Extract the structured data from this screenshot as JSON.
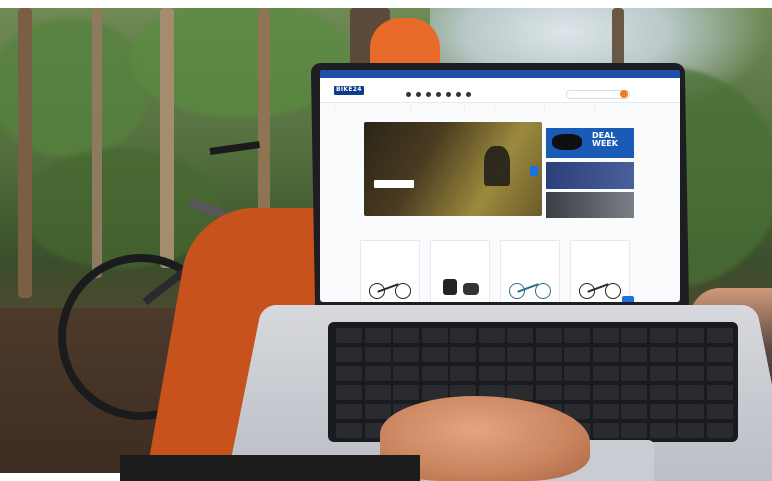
{
  "scene": {
    "description": "Laptop on a hammock in a forest showing a bike shop web page",
    "colors": {
      "hammock": "#e86a2a",
      "brand_blue": "#1f4fa8",
      "deal_blue": "#1a5bb5",
      "cart_orange": "#f07c22"
    }
  },
  "site": {
    "topbar_text": "",
    "logo_text": "BIKE24",
    "header_links": [
      "",
      ""
    ],
    "nav_items": [
      "",
      "",
      "",
      "",
      "",
      ""
    ],
    "hero": {
      "title_line1": "",
      "title_line2": "",
      "button_label": ""
    },
    "deal": {
      "title": "DEAL WEEK",
      "subtitle": ""
    },
    "promo2_text": "",
    "promo3_text": "",
    "section_heading": "",
    "cards": [
      {
        "brand": "",
        "name": ""
      },
      {
        "brand": "",
        "name": ""
      },
      {
        "brand": "",
        "name": ""
      },
      {
        "brand": "",
        "name": ""
      }
    ]
  }
}
